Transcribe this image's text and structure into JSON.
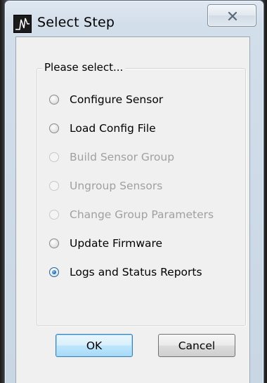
{
  "window": {
    "title": "Select Step",
    "icon": "app-waveform-icon",
    "close_icon": "close-x-icon"
  },
  "group": {
    "title": "Please select..."
  },
  "options": [
    {
      "label": "Configure Sensor",
      "enabled": true,
      "checked": false
    },
    {
      "label": "Load Config File",
      "enabled": true,
      "checked": false
    },
    {
      "label": "Build Sensor Group",
      "enabled": false,
      "checked": false
    },
    {
      "label": "Ungroup Sensors",
      "enabled": false,
      "checked": false
    },
    {
      "label": "Change Group Parameters",
      "enabled": false,
      "checked": false
    },
    {
      "label": "Update Firmware",
      "enabled": true,
      "checked": false
    },
    {
      "label": "Logs and Status Reports",
      "enabled": true,
      "checked": true
    }
  ],
  "buttons": {
    "ok_label": "OK",
    "cancel_label": "Cancel"
  },
  "colors": {
    "disabled_text": "#a0a0a0",
    "default_button_border": "#3c7fb1"
  }
}
